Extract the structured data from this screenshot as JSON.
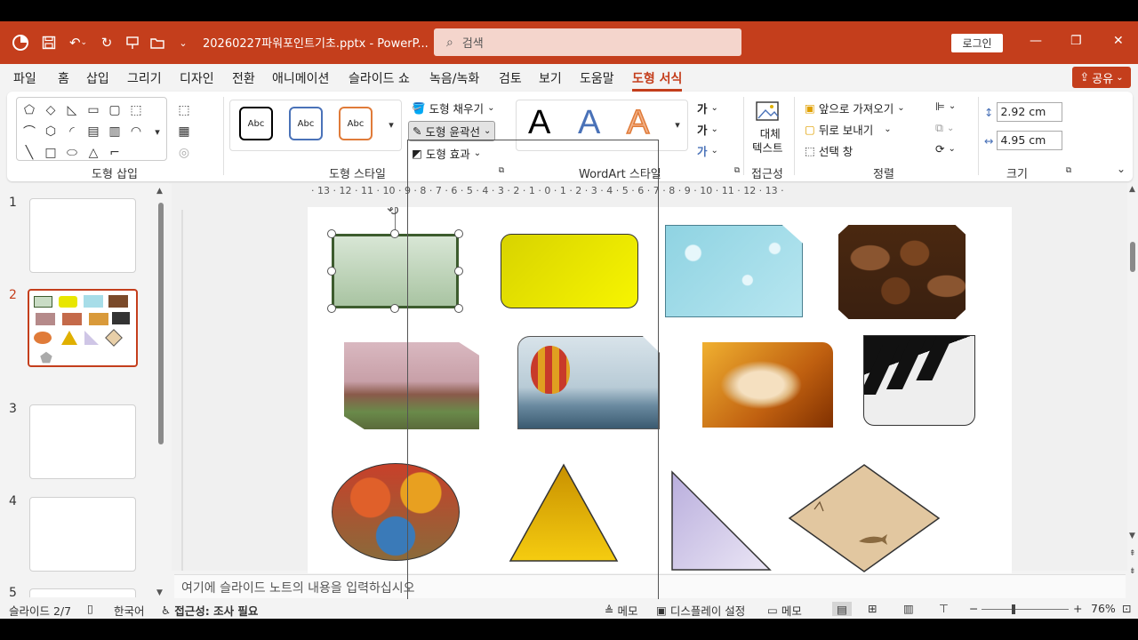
{
  "window": {
    "doc_title": "20260227파워포인트기초.pptx  -  PowerP...",
    "search_placeholder": "검색",
    "login_label": "로그인",
    "minimize": "—",
    "restore": "❐",
    "close": "✕"
  },
  "tabs": [
    "파일",
    "홈",
    "삽입",
    "그리기",
    "디자인",
    "전환",
    "애니메이션",
    "슬라이드 쇼",
    "녹음/녹화",
    "검토",
    "보기",
    "도움말",
    "도형 서식"
  ],
  "active_tab": "도형 서식",
  "share_label": "공유",
  "ribbon": {
    "groups": {
      "insert_shapes": "도형 삽입",
      "shape_styles": "도형 스타일",
      "wordart_styles": "WordArt 스타일",
      "accessibility": "접근성",
      "arrange": "정렬",
      "size": "크기"
    },
    "style_sample_text": "Abc",
    "shape_fill": "도형 채우기",
    "shape_outline": "도형 윤곽선",
    "shape_effects": "도형 효과",
    "alt_text": [
      "대체",
      "텍스트"
    ],
    "bring_forward": "앞으로 가져오기",
    "send_backward": "뒤로 보내기",
    "selection_pane": "선택 창",
    "height_value": "2.92 cm",
    "width_value": "4.95 cm",
    "text_fill_glyph": "가",
    "wordart_glyph": "A"
  },
  "ruler": {
    "horizontal": "· 13 · 12 · 11 · 10 · 9 · 8 · 7 · 6 · 5 · 4 · 3 · 2 · 1 · 0 · 1 · 2 · 3 · 4 · 5 · 6 · 7 · 8 · 9 · 10 · 11 · 12 · 13 ·"
  },
  "slides": [
    {
      "num": "1"
    },
    {
      "num": "2"
    },
    {
      "num": "3"
    },
    {
      "num": "4"
    },
    {
      "num": "5"
    }
  ],
  "active_slide": "2",
  "notes_placeholder": "여기에 슬라이드 노트의 내용을 입력하십시오",
  "status": {
    "slide_counter": "슬라이드 2/7",
    "language": "한국어",
    "accessibility": "접근성: 조사 필요",
    "notes": "메모",
    "display_settings": "디스플레이 설정",
    "comments": "메모",
    "zoom": "76%"
  },
  "colors": {
    "accent": "#c43e1c",
    "selected_rect_fill": "#c9dcc5",
    "selected_rect_border": "#3d5c2e",
    "yellow_rect": "#e8e600",
    "triangle": "#e0b000",
    "right_triangle": "#cfc6e6"
  }
}
